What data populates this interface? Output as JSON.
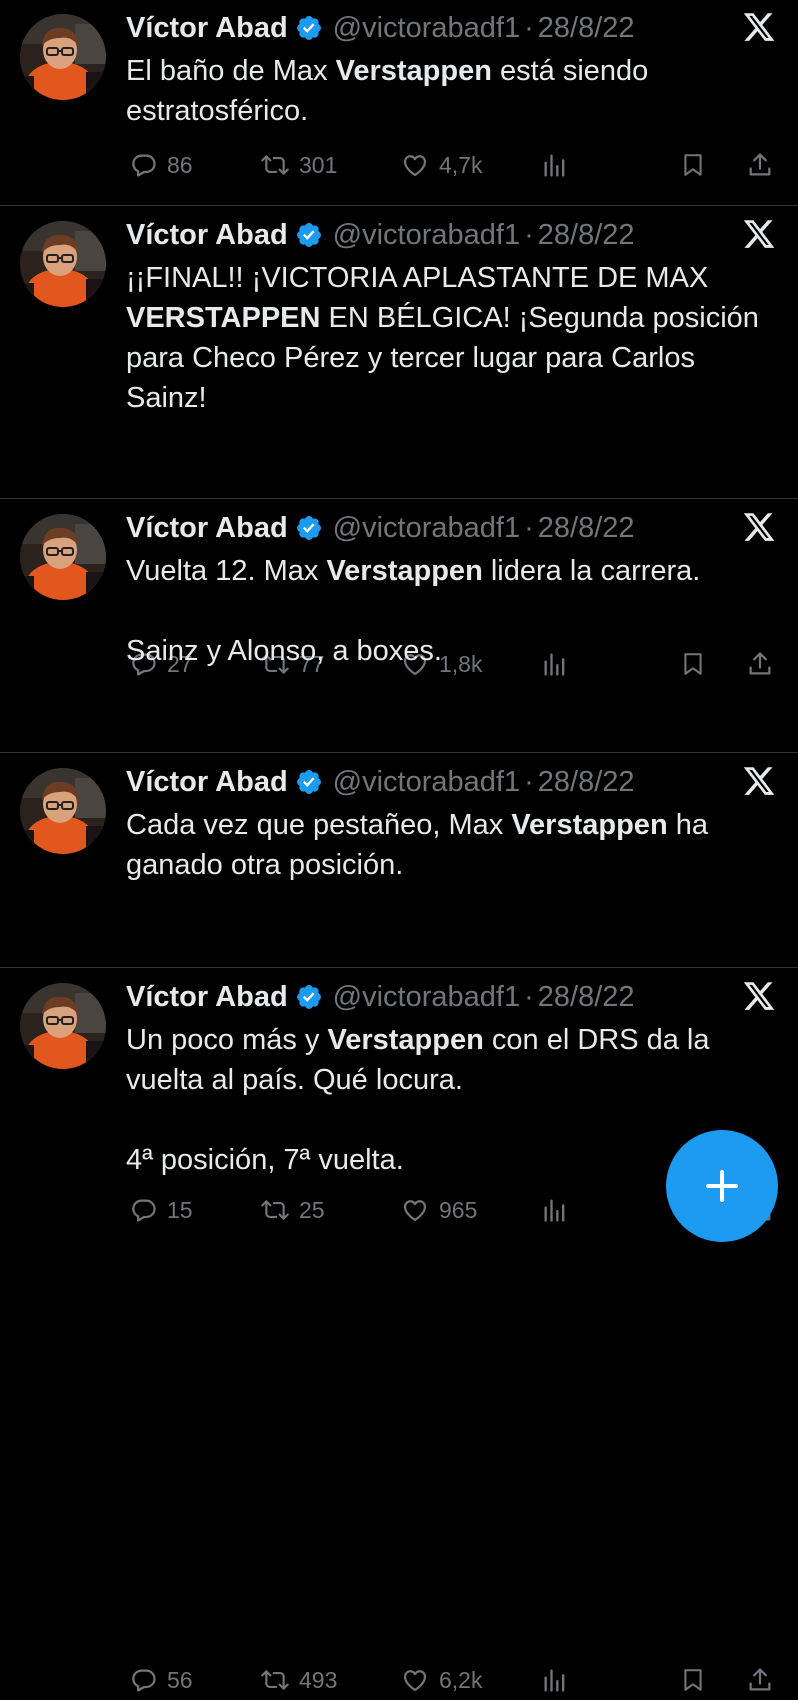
{
  "tweets": [
    {
      "name": "Víctor Abad",
      "handle": "@victorabadf1",
      "separator": "·",
      "date": "28/8/22",
      "body": [
        [
          {
            "t": "El baño de Max "
          },
          {
            "t": "Verstappen",
            "b": true
          },
          {
            "t": " está siendo"
          }
        ],
        [
          {
            "t": "estratosférico."
          }
        ]
      ],
      "replies": "86",
      "retweets": "301",
      "likes": "4,7k"
    },
    {
      "name": "Víctor Abad",
      "handle": "@victorabadf1",
      "separator": "·",
      "date": "28/8/22",
      "body": [
        [
          {
            "t": "¡¡FINAL!! ¡VICTORIA APLASTANTE DE MAX"
          }
        ],
        [
          {
            "t": "VERSTAPPEN",
            "b": true
          },
          {
            "t": " EN BÉLGICA! ¡Segunda posición"
          }
        ],
        [
          {
            "t": "para Checo Pérez y tercer lugar para Carlos"
          }
        ],
        [
          {
            "t": "Sainz!"
          }
        ]
      ],
      "replies": "27",
      "retweets": "77",
      "likes": "1,8k"
    },
    {
      "name": "Víctor Abad",
      "handle": "@victorabadf1",
      "separator": "·",
      "date": "28/8/22",
      "body": [
        [
          {
            "t": "Vuelta 12. Max "
          },
          {
            "t": "Verstappen",
            "b": true
          },
          {
            "t": " lidera la carrera."
          }
        ],
        [],
        [
          {
            "t": "Sainz y Alonso, a boxes."
          }
        ]
      ],
      "replies": "15",
      "retweets": "25",
      "likes": "965"
    },
    {
      "name": "Víctor Abad",
      "handle": "@victorabadf1",
      "separator": "·",
      "date": "28/8/22",
      "body": [
        [
          {
            "t": "Cada vez que pestañeo, Max "
          },
          {
            "t": "Verstappen",
            "b": true
          },
          {
            "t": " ha"
          }
        ],
        [
          {
            "t": "ganado otra posición."
          }
        ]
      ],
      "replies": "56",
      "retweets": "493",
      "likes": "6,2k"
    },
    {
      "name": "Víctor Abad",
      "handle": "@victorabadf1",
      "separator": "·",
      "date": "28/8/22",
      "body": [
        [
          {
            "t": "Un poco más y "
          },
          {
            "t": "Verstappen",
            "b": true
          },
          {
            "t": " con el DRS da la"
          }
        ],
        [
          {
            "t": "vuelta al país. Qué locura."
          }
        ],
        [],
        [
          {
            "t": "4ª posición, 7ª vuelta."
          }
        ]
      ],
      "replies": "",
      "retweets": "",
      "likes": ""
    }
  ],
  "colors": {
    "background": "#000000",
    "text": "#e7e9ea",
    "secondary": "#71767b",
    "verified": "#1d9bf0",
    "fab": "#1d9bf0",
    "divider": "#2f3336"
  },
  "icons": {
    "reply": "reply-icon",
    "retweet": "retweet-icon",
    "like": "heart-icon",
    "views": "views-icon",
    "bookmark": "bookmark-icon",
    "share": "share-icon",
    "x": "x-logo-icon",
    "verified": "verified-badge-icon",
    "compose": "plus-icon"
  }
}
